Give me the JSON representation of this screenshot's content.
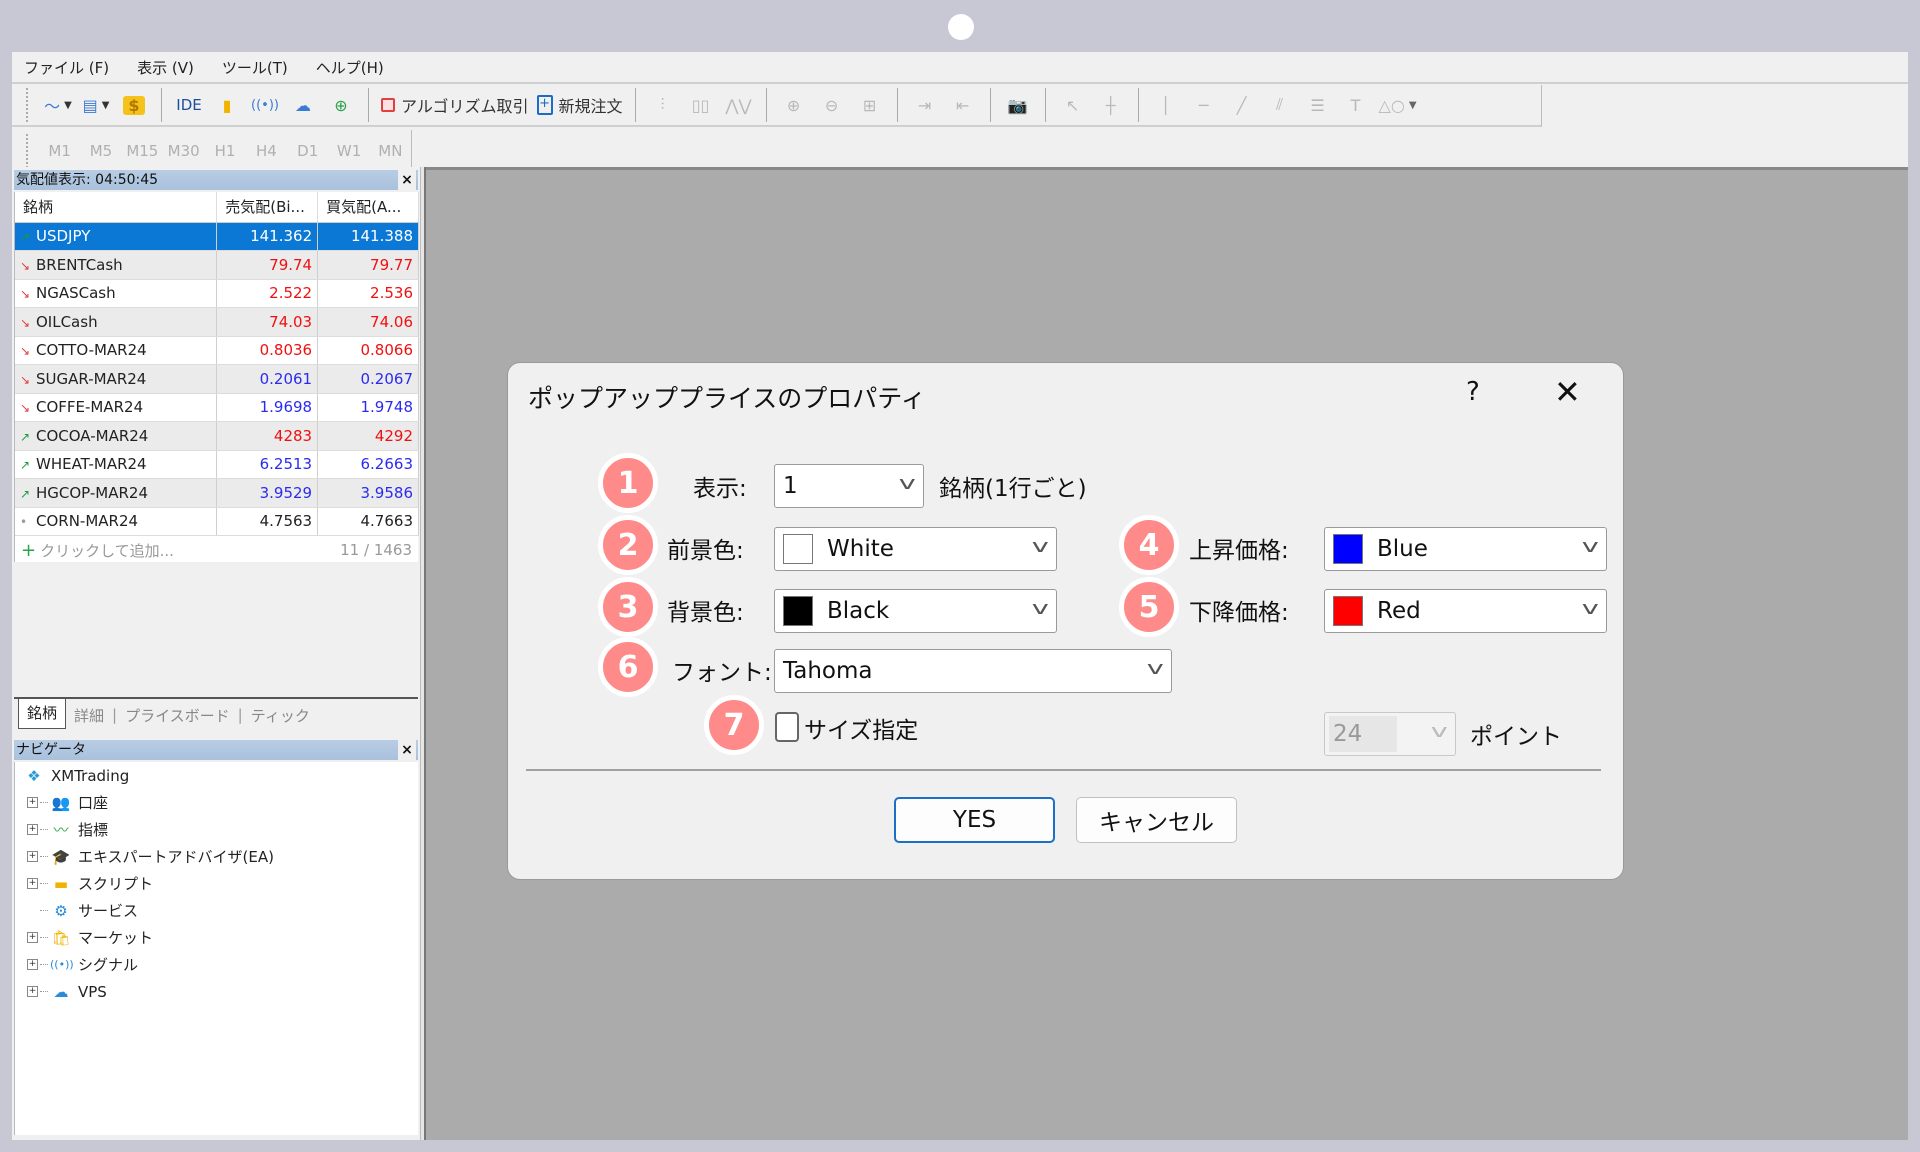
{
  "menu": [
    "ファイル (F)",
    "表示 (V)",
    "ツール(T)",
    "ヘルプ(H)"
  ],
  "toolbar": {
    "ide_label": "IDE",
    "algo_trading_label": "アルゴリズム取引",
    "new_order_label": "新規注文"
  },
  "timeframes": [
    "M1",
    "M5",
    "M15",
    "M30",
    "H1",
    "H4",
    "D1",
    "W1",
    "MN"
  ],
  "market_watch": {
    "title": "気配値表示: 04:50:45",
    "close": "×",
    "columns": [
      "銘柄",
      "売気配(Bi...",
      "買気配(A..."
    ],
    "rows": [
      {
        "symbol": "USDJPY",
        "trend": "up",
        "bid": "141.362",
        "ask": "141.388",
        "color": "black",
        "selected": true
      },
      {
        "symbol": "BRENTCash",
        "trend": "down",
        "bid": "79.74",
        "ask": "79.77",
        "color": "red"
      },
      {
        "symbol": "NGASCash",
        "trend": "down",
        "bid": "2.522",
        "ask": "2.536",
        "color": "red"
      },
      {
        "symbol": "OILCash",
        "trend": "down",
        "bid": "74.03",
        "ask": "74.06",
        "color": "red"
      },
      {
        "symbol": "COTTO-MAR24",
        "trend": "down",
        "bid": "0.8036",
        "ask": "0.8066",
        "color": "red"
      },
      {
        "symbol": "SUGAR-MAR24",
        "trend": "down",
        "bid": "0.2061",
        "ask": "0.2067",
        "color": "blue"
      },
      {
        "symbol": "COFFE-MAR24",
        "trend": "down",
        "bid": "1.9698",
        "ask": "1.9748",
        "color": "blue"
      },
      {
        "symbol": "COCOA-MAR24",
        "trend": "up",
        "bid": "4283",
        "ask": "4292",
        "color": "red"
      },
      {
        "symbol": "WHEAT-MAR24",
        "trend": "up",
        "bid": "6.2513",
        "ask": "6.2663",
        "color": "blue"
      },
      {
        "symbol": "HGCOP-MAR24",
        "trend": "up",
        "bid": "3.9529",
        "ask": "3.9586",
        "color": "blue"
      },
      {
        "symbol": "CORN-MAR24",
        "trend": "flat",
        "bid": "4.7563",
        "ask": "4.7663",
        "color": "black"
      }
    ],
    "add_label": "クリックして追加...",
    "count": "11 / 1463",
    "tabs": [
      "銘柄",
      "詳細",
      "プライスボード",
      "ティック"
    ]
  },
  "navigator": {
    "title": "ナビゲータ",
    "close": "×",
    "root": "XMTrading",
    "items": [
      {
        "label": "口座",
        "icon": "accounts-icon",
        "glyph": "👥",
        "expandable": true
      },
      {
        "label": "指標",
        "icon": "indicators-icon",
        "glyph": "〰",
        "expandable": true
      },
      {
        "label": "エキスパートアドバイザ(EA)",
        "icon": "expert-advisor-icon",
        "glyph": "🎓",
        "expandable": true
      },
      {
        "label": "スクリプト",
        "icon": "script-icon",
        "glyph": "▬",
        "expandable": true
      },
      {
        "label": "サービス",
        "icon": "service-icon",
        "glyph": "⚙",
        "expandable": false
      },
      {
        "label": "マーケット",
        "icon": "market-icon",
        "glyph": "🛍",
        "expandable": true
      },
      {
        "label": "シグナル",
        "icon": "signal-icon",
        "glyph": "((•))",
        "expandable": true
      },
      {
        "label": "VPS",
        "icon": "vps-icon",
        "glyph": "☁",
        "expandable": true
      }
    ]
  },
  "dialog": {
    "title": "ポップアッププライスのプロパティ",
    "help": "?",
    "close": "✕",
    "badges": [
      "1",
      "2",
      "3",
      "4",
      "5",
      "6",
      "7"
    ],
    "display_label": "表示:",
    "display_value": "1",
    "display_suffix": "銘柄(1行ごと)",
    "foreground_label": "前景色:",
    "foreground_value": "White",
    "foreground_color": "#ffffff",
    "background_label": "背景色:",
    "background_value": "Black",
    "background_color": "#000000",
    "rise_label": "上昇価格:",
    "rise_value": "Blue",
    "rise_color": "#0000ff",
    "fall_label": "下降価格:",
    "fall_value": "Red",
    "fall_color": "#ff0000",
    "font_label": "フォント:",
    "font_value": "Tahoma",
    "size_checkbox_label": "サイズ指定",
    "size_checked": false,
    "size_value": "24",
    "size_unit": "ポイント",
    "ok_label": "YES",
    "cancel_label": "キャンセル"
  }
}
